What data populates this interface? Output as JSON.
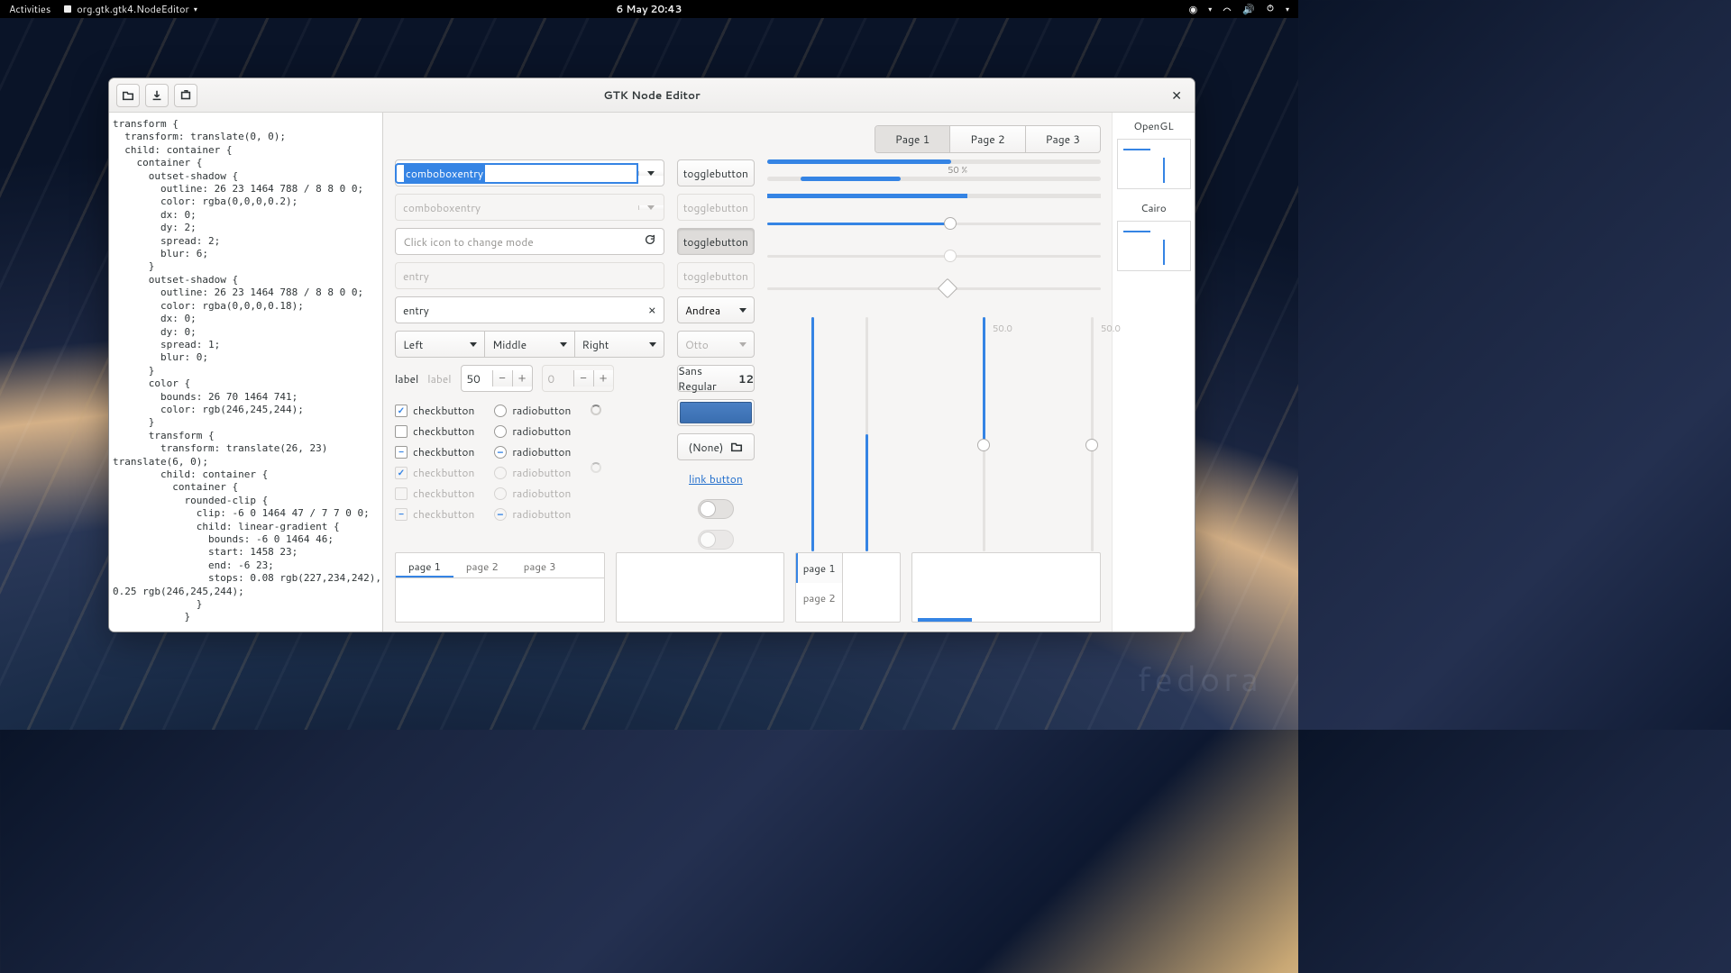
{
  "topbar": {
    "activities": "Activities",
    "app_name": "org.gtk.gtk4.NodeEditor",
    "clock": "6 May  20:43"
  },
  "desktop": {
    "distro": "fedora"
  },
  "window": {
    "title": "GTK Node Editor",
    "code": "transform {\n  transform: translate(0, 0);\n  child: container {\n    container {\n      outset-shadow {\n        outline: 26 23 1464 788 / 8 8 0 0;\n        color: rgba(0,0,0,0.2);\n        dx: 0;\n        dy: 2;\n        spread: 2;\n        blur: 6;\n      }\n      outset-shadow {\n        outline: 26 23 1464 788 / 8 8 0 0;\n        color: rgba(0,0,0,0.18);\n        dx: 0;\n        dy: 0;\n        spread: 1;\n        blur: 0;\n      }\n      color {\n        bounds: 26 70 1464 741;\n        color: rgb(246,245,244);\n      }\n      transform {\n        transform: translate(26, 23)\ntranslate(6, 0);\n        child: container {\n          container {\n            rounded-clip {\n              clip: -6 0 1464 47 / 7 7 0 0;\n              child: linear-gradient {\n                bounds: -6 0 1464 46;\n                start: 1458 23;\n                end: -6 23;\n                stops: 0.08 rgb(227,234,242),\n0.25 rgb(246,245,244);\n              }\n            }"
  },
  "switcher": {
    "p1": "Page 1",
    "p2": "Page 2",
    "p3": "Page 3"
  },
  "col1": {
    "combo1": "comboboxentry",
    "combo2_ph": "comboboxentry",
    "icon_entry_ph": "Click icon to change mode",
    "entry_ph": "entry",
    "entry_val": "entry",
    "dd_left": "Left",
    "dd_mid": "Middle",
    "dd_right": "Right",
    "label1": "label",
    "label2": "label",
    "spin1": "50",
    "spin2": "0",
    "check": "checkbutton",
    "radio": "radiobutton"
  },
  "col2": {
    "toggle": "togglebutton",
    "andrea": "Andrea",
    "otto": "Otto",
    "font": "Sans Regular",
    "font_size": "12",
    "none": "(None)",
    "link": "link button"
  },
  "col3": {
    "pct": "50 %",
    "v50a": "50.0",
    "v50b": "50.0"
  },
  "renderers": {
    "opengl": "OpenGL",
    "cairo": "Cairo"
  },
  "bottom": {
    "p1": "page 1",
    "p2": "page 2",
    "p3": "page 3"
  }
}
